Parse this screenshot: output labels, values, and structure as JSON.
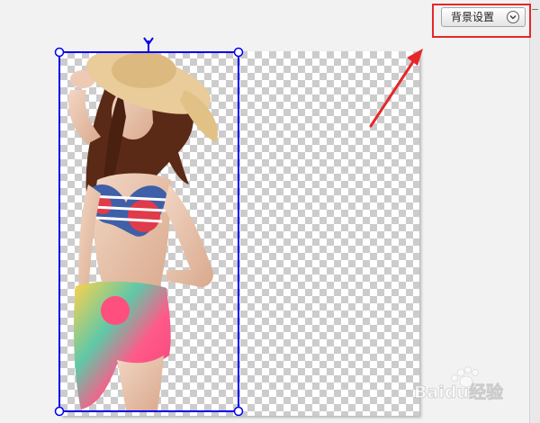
{
  "toolbar": {
    "background_settings_label": "背景设置"
  },
  "canvas": {
    "background": "transparent-checkerboard"
  },
  "selection": {
    "handle_color": "#0000ee",
    "rotate_handle": "rotate-handle"
  },
  "annotation": {
    "highlight_color": "#e5272b",
    "arrow_color": "#e5272b"
  },
  "watermark": {
    "text": "Baidu经验"
  },
  "icons": {
    "dropdown": "chevron-down-circle-icon"
  }
}
